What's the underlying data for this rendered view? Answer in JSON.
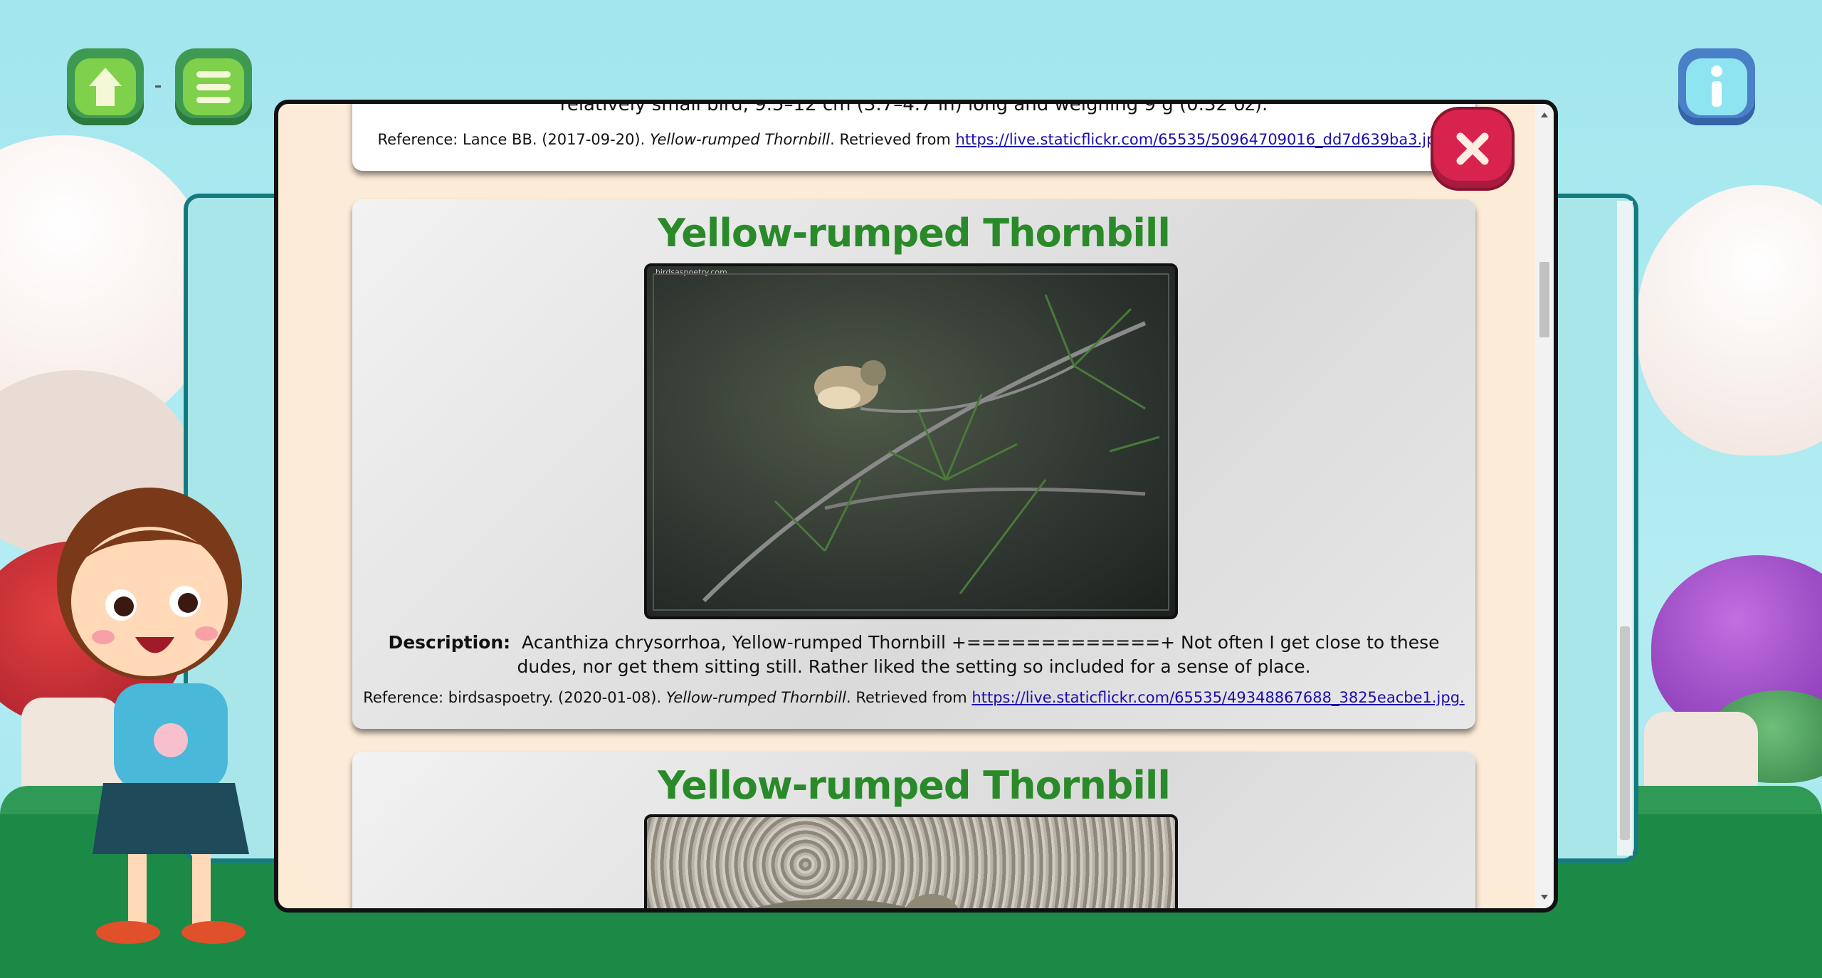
{
  "nav": {
    "home_icon": "home-icon",
    "menu_icon": "menu-icon",
    "info_icon": "info-icon",
    "separator": "-"
  },
  "modal": {
    "close_icon": "close-icon",
    "previous_card": {
      "text": "relatively small bird, 9.5–12 cm (3.7–4.7 in) long and weighing 9 g (0.32 oz).",
      "reference_prefix": "Reference: Lance BB. (2017-09-20). ",
      "reference_title": "Yellow-rumped Thornbill",
      "reference_mid": ". Retrieved from ",
      "reference_link": "https://live.staticflickr.com/65535/50964709016_dd7d639ba3.jpg."
    },
    "cards": [
      {
        "title": "Yellow-rumped Thornbill",
        "watermark": "birdsaspoetry.com",
        "description_label": "Description:",
        "description": "Acanthiza chrysorrhoa, Yellow-rumped Thornbill +=============+ Not often I get close to these dudes, nor get them sitting still. Rather liked the setting so included for a sense of place.",
        "reference_prefix": "Reference: birdsaspoetry. (2020-01-08). ",
        "reference_title": "Yellow-rumped Thornbill",
        "reference_mid": ". Retrieved from ",
        "reference_link": "https://live.staticflickr.com/65535/49348867688_3825eacbe1.jpg."
      },
      {
        "title": "Yellow-rumped Thornbill"
      }
    ]
  },
  "colors": {
    "title_green": "#2a8a2a",
    "modal_bg": "#fcebd7",
    "close_red": "#d9234f",
    "button_green": "#7fd04a",
    "info_blue": "#8fe4f2"
  }
}
